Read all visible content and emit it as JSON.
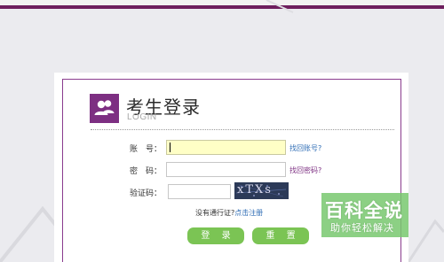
{
  "header": {
    "title": "考生登录",
    "subtitle": "LOGIN"
  },
  "form": {
    "account_label": "账　号：",
    "account_value": "",
    "forgot_account": "找回账号?",
    "password_label": "密　码：",
    "password_value": "",
    "forgot_password": "找回密码?",
    "captcha_label": "验证码：",
    "captcha_value": "",
    "captcha_text": "xTXs"
  },
  "register": {
    "prompt": "没有通行证?",
    "link": "点击注册"
  },
  "buttons": {
    "login": "登 录",
    "reset": "重 置"
  },
  "watermark": {
    "title": "百科全说",
    "subtitle": "助你轻松解决"
  },
  "colors": {
    "accent_purple": "#7d2f82",
    "button_green": "#7bc454",
    "link_blue": "#2f6db5",
    "focused_input": "#ffffc6"
  },
  "icons": {
    "logo": "users-icon"
  }
}
